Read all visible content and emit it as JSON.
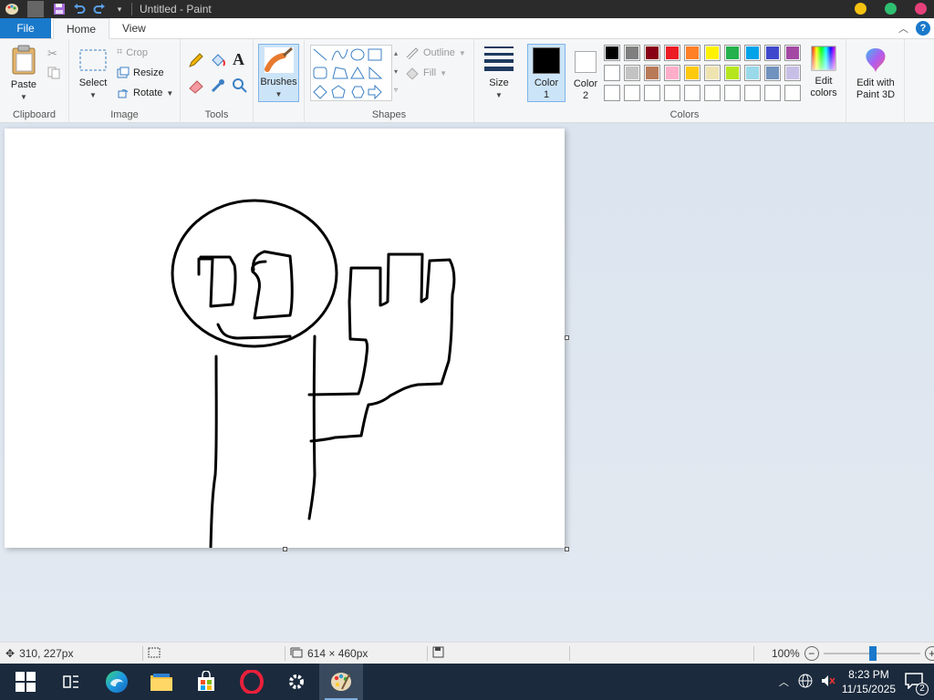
{
  "window": {
    "title": "Untitled - Paint"
  },
  "tabs": {
    "file": "File",
    "home": "Home",
    "view": "View"
  },
  "clipboard": {
    "paste": "Paste",
    "label": "Clipboard"
  },
  "image": {
    "select": "Select",
    "crop": "Crop",
    "resize": "Resize",
    "rotate": "Rotate",
    "label": "Image"
  },
  "tools": {
    "label": "Tools"
  },
  "brushes": {
    "label": "Brushes"
  },
  "shapes": {
    "outline": "Outline",
    "fill": "Fill",
    "label": "Shapes"
  },
  "size": {
    "label": "Size"
  },
  "colors": {
    "color1": "Color",
    "color1_num": "1",
    "color2": "Color",
    "color2_num": "2",
    "color1_value": "#000000",
    "color2_value": "#ffffff",
    "edit_colors_1": "Edit",
    "edit_colors_2": "colors",
    "label": "Colors",
    "palette_row1": [
      "#000000",
      "#7f7f7f",
      "#880015",
      "#ed1c24",
      "#ff7f27",
      "#fff200",
      "#22b14c",
      "#00a2e8",
      "#3f48cc",
      "#a349a4"
    ],
    "palette_row2": [
      "#ffffff",
      "#c3c3c3",
      "#b97a57",
      "#ffaec9",
      "#ffc90e",
      "#efe4b0",
      "#b5e61d",
      "#99d9ea",
      "#7092be",
      "#c8bfe7"
    ],
    "palette_row3": [
      "#ffffff",
      "#ffffff",
      "#ffffff",
      "#ffffff",
      "#ffffff",
      "#ffffff",
      "#ffffff",
      "#ffffff",
      "#ffffff",
      "#ffffff"
    ]
  },
  "paint3d": {
    "line1": "Edit with",
    "line2": "Paint 3D"
  },
  "status": {
    "cursor": "310, 227px",
    "canvas_size": "614 × 460px",
    "zoom": "100%"
  },
  "clock": {
    "time": "8:23 PM",
    "date": "11/15/2025"
  },
  "notifications": {
    "count": "2"
  }
}
